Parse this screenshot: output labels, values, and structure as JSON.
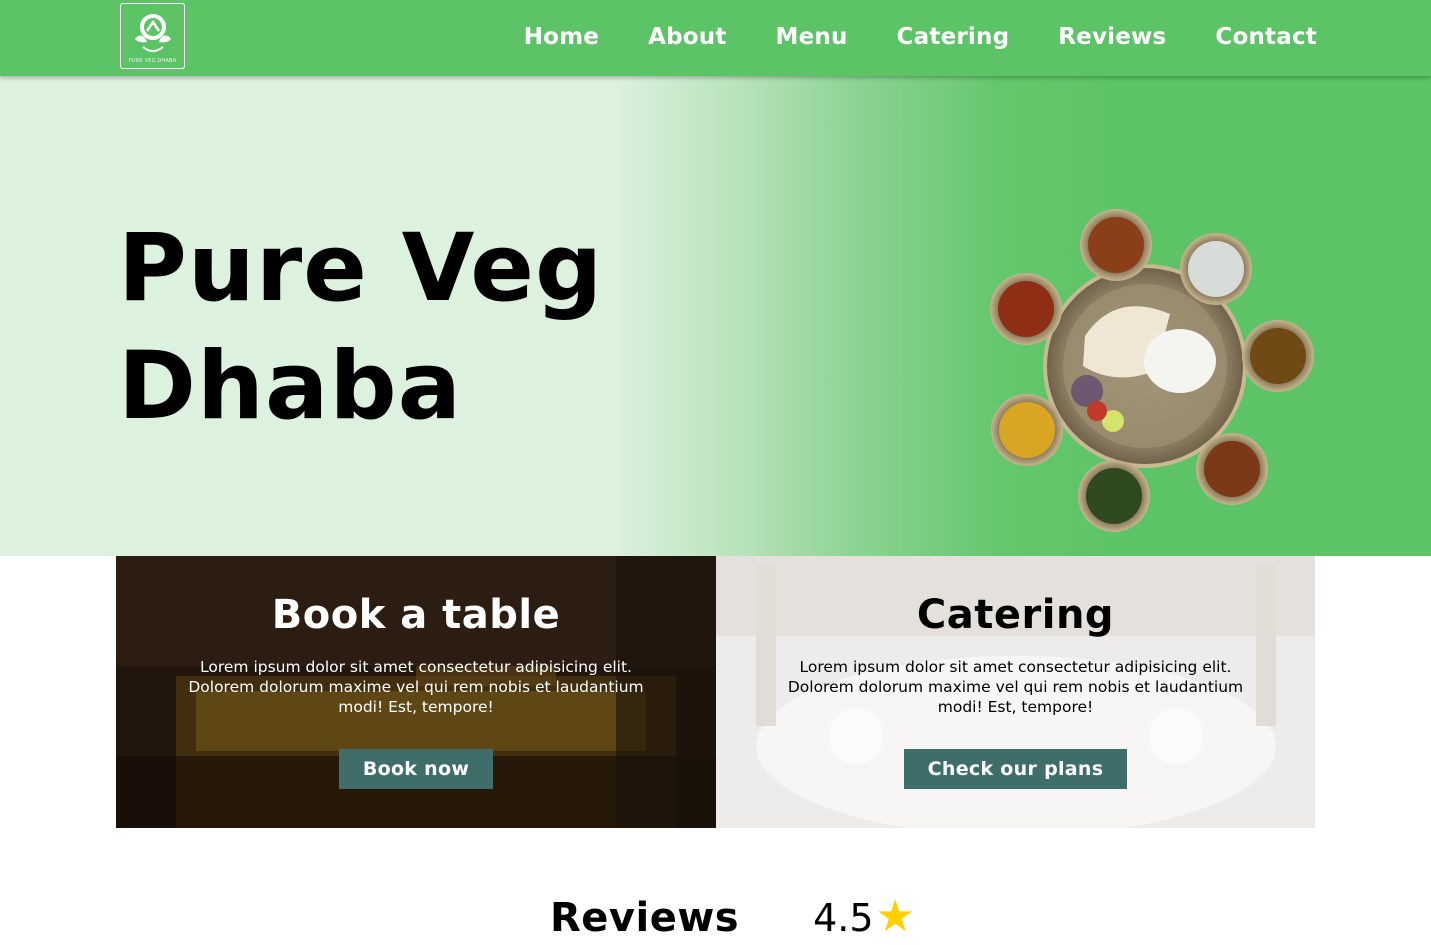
{
  "nav": {
    "logo_text": "PURE VEG DHABA",
    "links": [
      "Home",
      "About",
      "Menu",
      "Catering",
      "Reviews",
      "Contact"
    ]
  },
  "hero": {
    "title_line1": "Pure Veg",
    "title_line2": "Dhaba"
  },
  "cards": [
    {
      "title": "Book a table",
      "text": "Lorem ipsum dolor sit amet consectetur adipisicing elit. Dolorem dolorum maxime vel qui rem nobis et laudantium modi! Est, tempore!",
      "button": "Book now"
    },
    {
      "title": "Catering",
      "text": "Lorem ipsum dolor sit amet consectetur adipisicing elit. Dolorem dolorum maxime vel qui rem nobis et laudantium modi! Est, tempore!",
      "button": "Check our plans"
    }
  ],
  "reviews": {
    "heading": "Reviews",
    "rating": "4.5",
    "star": "★"
  },
  "colors": {
    "brand_green": "#5cc466",
    "hero_light": "#dcf1de",
    "button": "#3f6d6a",
    "star": "#ffd000"
  }
}
